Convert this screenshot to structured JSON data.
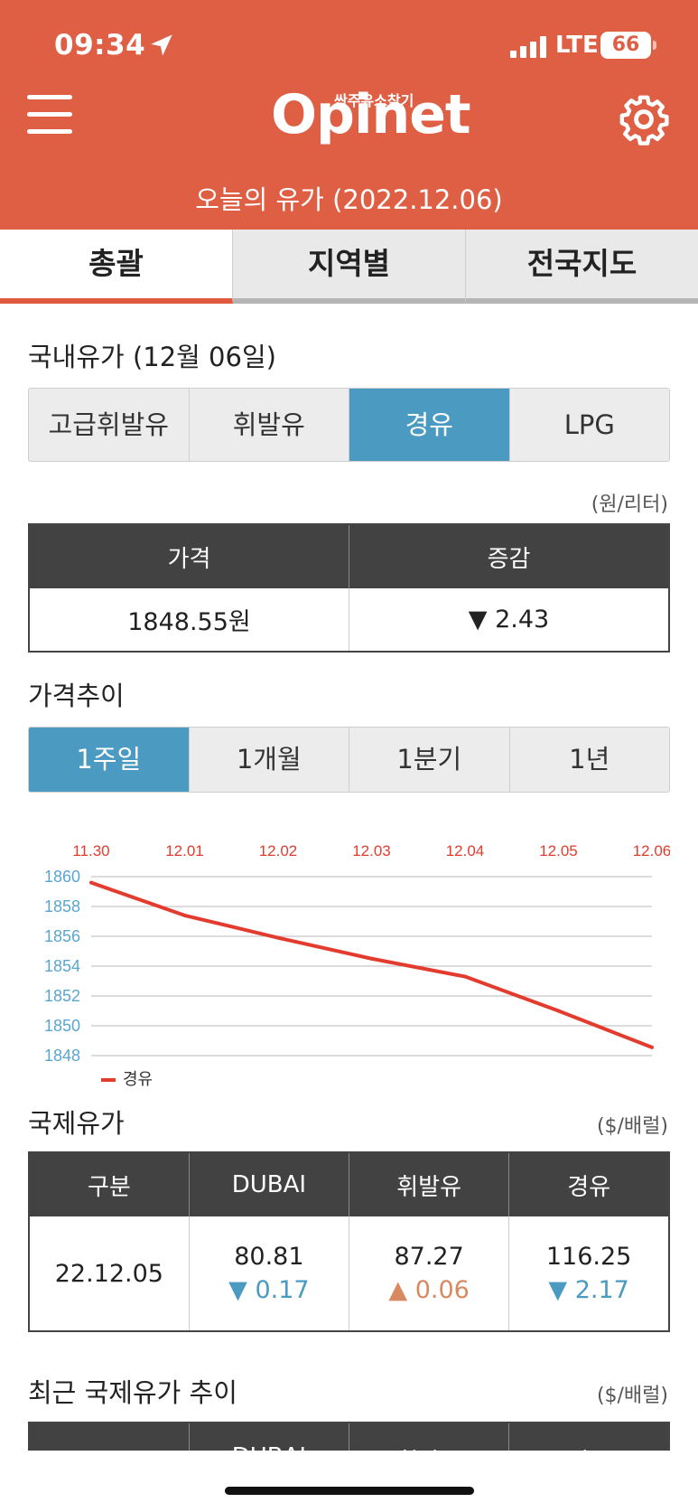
{
  "status_bar": {
    "time": "09:34",
    "network": "LTE",
    "battery": "66"
  },
  "header": {
    "logo_main": "Opinet",
    "logo_sub": "싼주유소찾기",
    "title": "오늘의 유가 (2022.12.06)"
  },
  "main_tabs": [
    {
      "label": "총괄",
      "active": true
    },
    {
      "label": "지역별",
      "active": false
    },
    {
      "label": "전국지도",
      "active": false
    }
  ],
  "domestic": {
    "title": "국내유가 (12월 06일)",
    "fuel_tabs": [
      {
        "label": "고급휘발유",
        "active": false
      },
      {
        "label": "휘발유",
        "active": false
      },
      {
        "label": "경유",
        "active": true
      },
      {
        "label": "LPG",
        "active": false
      }
    ],
    "unit": "(원/리터)",
    "headers": [
      "가격",
      "증감"
    ],
    "price": "1848.55원",
    "change": "▼ 2.43"
  },
  "trend": {
    "title": "가격추이",
    "period_tabs": [
      {
        "label": "1주일",
        "active": true
      },
      {
        "label": "1개월",
        "active": false
      },
      {
        "label": "1분기",
        "active": false
      },
      {
        "label": "1년",
        "active": false
      }
    ]
  },
  "chart_data": {
    "type": "line",
    "x": [
      "11.30",
      "12.01",
      "12.02",
      "12.03",
      "12.04",
      "12.05",
      "12.06"
    ],
    "series": [
      {
        "name": "경유",
        "values": [
          1859.6,
          1857.4,
          1855.9,
          1854.5,
          1853.3,
          1851.0,
          1848.55
        ],
        "color": "#e33b2e"
      }
    ],
    "ylim": [
      1848,
      1860
    ],
    "yticks": [
      1860,
      1858,
      1856,
      1854,
      1852,
      1850,
      1848
    ],
    "grid": true,
    "legend_position": "bottom-left"
  },
  "international": {
    "title": "국제유가",
    "unit": "($/배럴)",
    "headers": [
      "구분",
      "DUBAI",
      "휘발유",
      "경유"
    ],
    "row": {
      "date": "22.12.05",
      "dubai": "80.81",
      "dubai_change": "▼ 0.17",
      "gasoline": "87.27",
      "gasoline_change": "▲ 0.06",
      "diesel": "116.25",
      "diesel_change": "▼ 2.17"
    }
  },
  "recent_international": {
    "title": "최근 국제유가 추이",
    "unit": "($/배럴)",
    "headers": [
      "구분",
      "DUBAI",
      "휘발유",
      "경유"
    ]
  },
  "colors": {
    "header": "#df5f45",
    "accent_blue": "#4a9ac2",
    "chart_line": "#e33b2e",
    "up": "#d9895f"
  }
}
